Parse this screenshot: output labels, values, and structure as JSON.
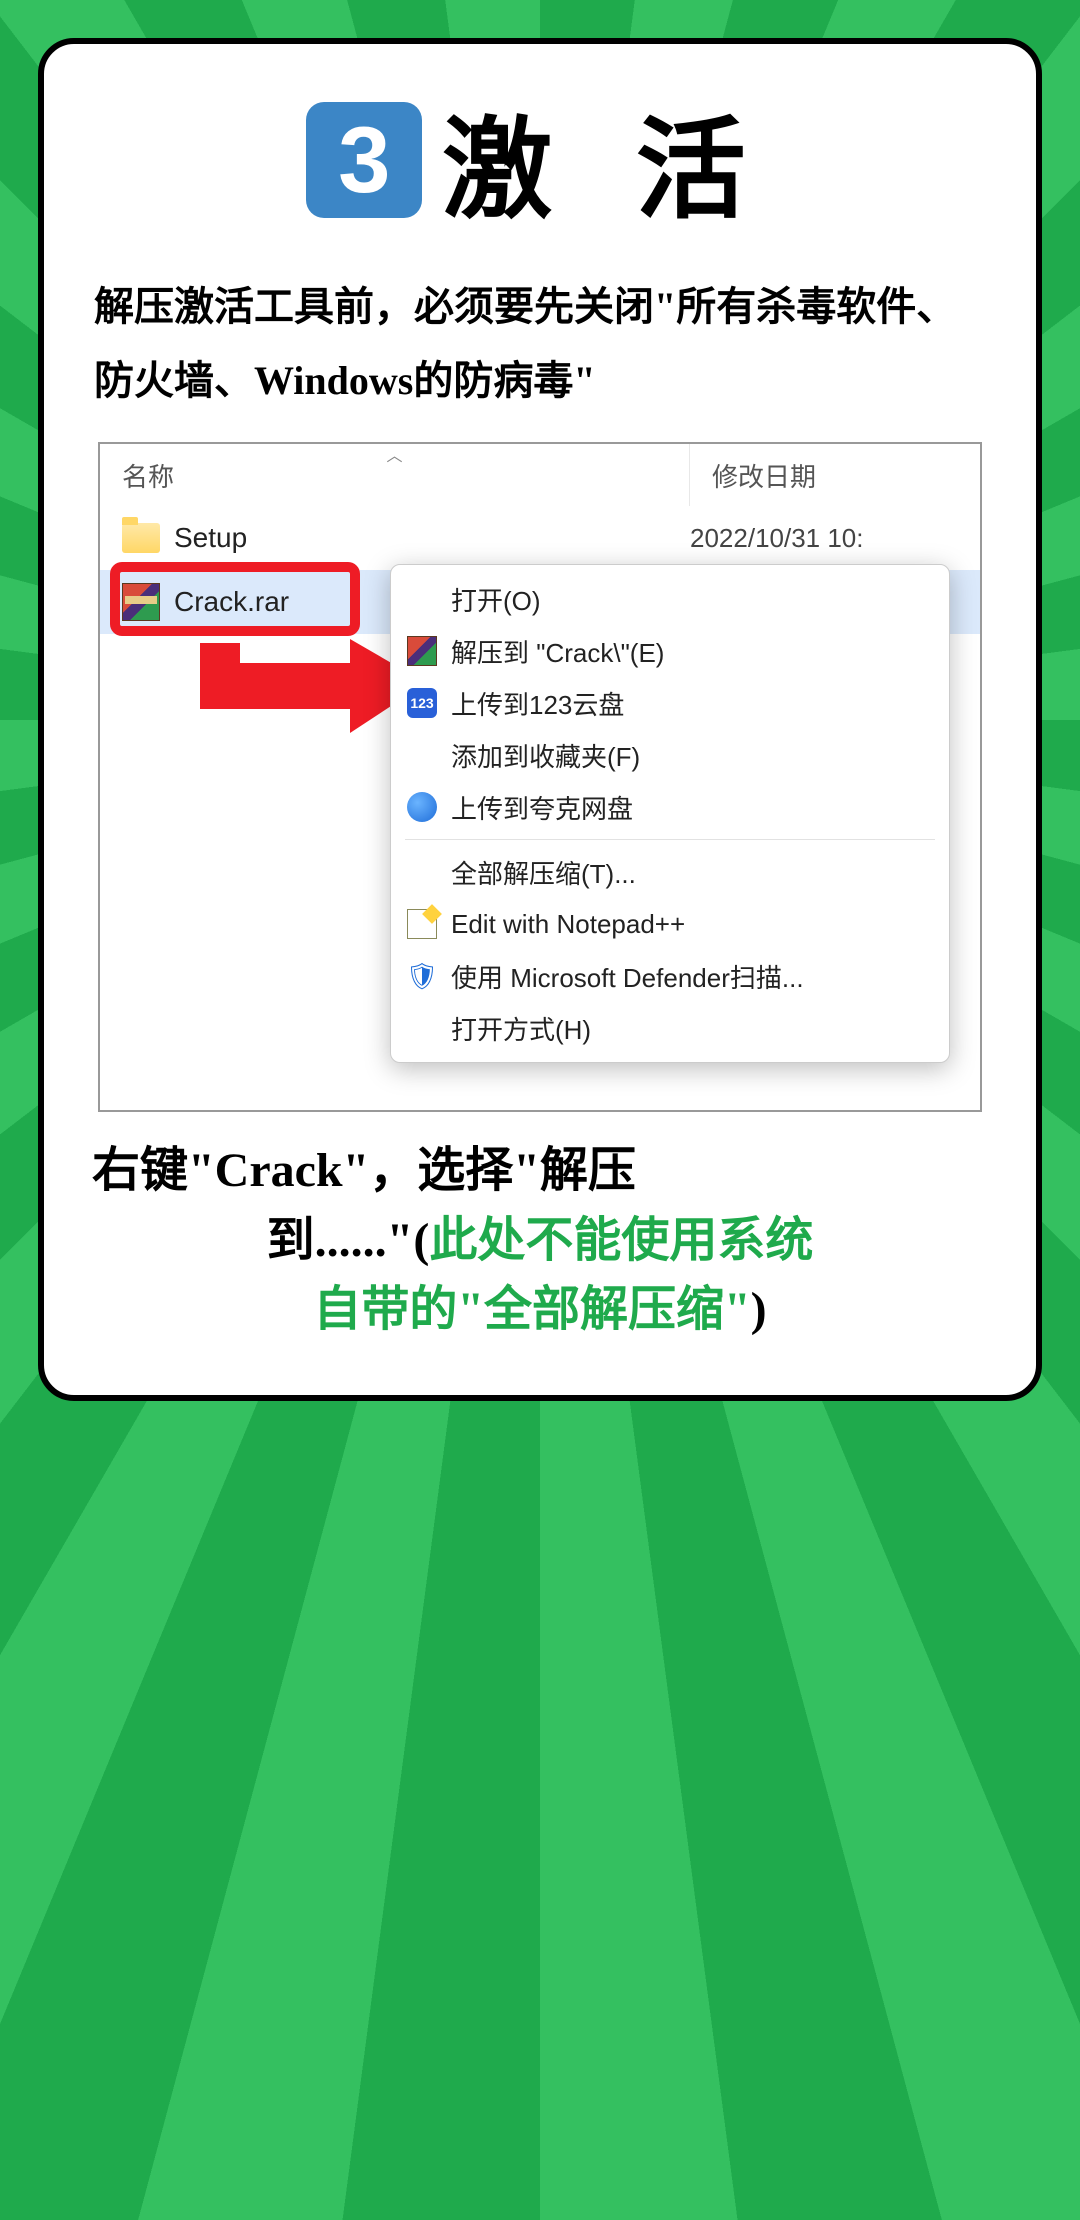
{
  "header": {
    "step_number": "3",
    "title": "激 活"
  },
  "instruction": "解压激活工具前，必须要先关闭\"所有杀毒软件、防火墙、Windows的防病毒\"",
  "explorer": {
    "col_name": "名称",
    "col_date": "修改日期",
    "rows": {
      "setup": {
        "label": "Setup",
        "date": "2022/10/31 10:"
      },
      "crack": {
        "label": "Crack.rar"
      }
    }
  },
  "context_menu": {
    "open": "打开(O)",
    "extract_to": "解压到 \"Crack\\\"(E)",
    "upload_123": "上传到123云盘",
    "add_favorite": "添加到收藏夹(F)",
    "upload_quark": "上传到夸克网盘",
    "extract_all": "全部解压缩(T)...",
    "edit_npp": "Edit with Notepad++",
    "defender_scan": "使用 Microsoft Defender扫描...",
    "open_with": "打开方式(H)"
  },
  "footer": {
    "line1a": "右键\"Crack\"，选择\"解压",
    "line2a": "到......\"(",
    "line2b": "此处不能使用系统",
    "line3a": "自带的\"全部解压缩\"",
    "line3b": ")"
  }
}
